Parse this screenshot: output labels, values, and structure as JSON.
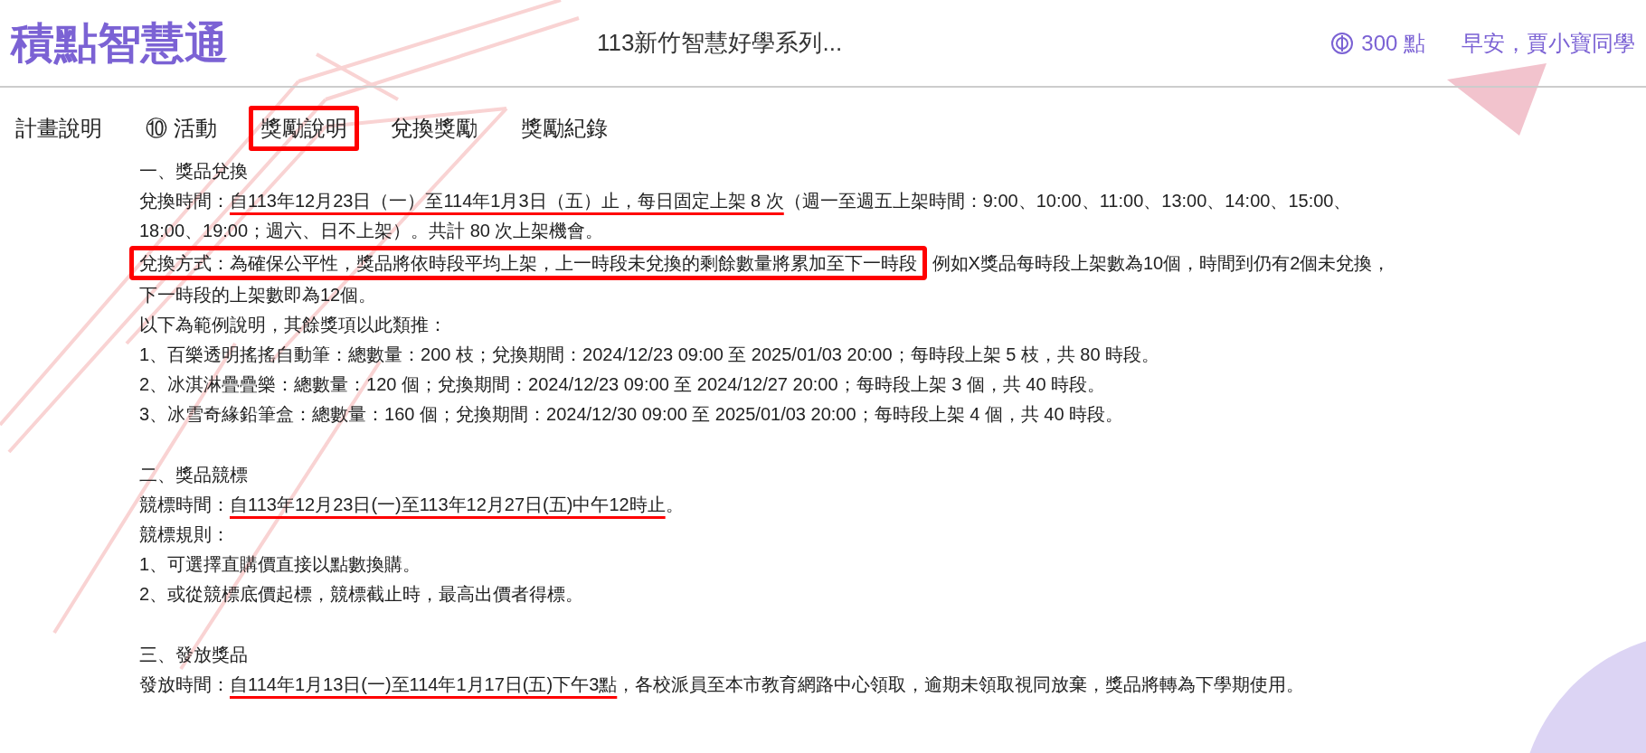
{
  "header": {
    "logo": "積點智慧通",
    "title": "113新竹智慧好學系列...",
    "points": "300 點",
    "greeting": "早安，賈小寶同學"
  },
  "tabs": [
    {
      "label": "計畫說明",
      "selected": false
    },
    {
      "label": "⑩ 活動",
      "selected": false
    },
    {
      "label": "獎勵說明",
      "selected": true
    },
    {
      "label": "兌換獎勵",
      "selected": false
    },
    {
      "label": "獎勵紀錄",
      "selected": false
    }
  ],
  "sections": [
    {
      "heading": "一、獎品兌換",
      "lines": [
        {
          "segments": [
            {
              "text": "兌換時間："
            },
            {
              "text": "自113年12月23日（一）至114年1月3日（五）止，每日固定上架 8 次",
              "underlined": true
            },
            {
              "text": "（週一至週五上架時間：9:00、10:00、11:00、13:00、14:00、15:00、"
            }
          ]
        },
        {
          "segments": [
            {
              "text": "18:00、19:00；週六、日不上架）。共計 80 次上架機會。"
            }
          ]
        },
        {
          "segments": [
            {
              "text": "兌換方式：為確保公平性，獎品將依時段平均上架，上一時段未兌換的剩餘數量將累加至下一時段",
              "boxed": true
            },
            {
              "text": " 例如X獎品每時段上架數為10個，時間到仍有2個未兌換，"
            }
          ]
        },
        {
          "segments": [
            {
              "text": "下一時段的上架數即為12個。"
            }
          ]
        },
        {
          "segments": [
            {
              "text": "以下為範例說明，其餘獎項以此類推："
            }
          ]
        },
        {
          "segments": [
            {
              "text": "1、百樂透明搖搖自動筆：總數量：200 枝；兌換期間：2024/12/23 09:00 至 2025/01/03 20:00；每時段上架 5 枝，共 80 時段。"
            }
          ]
        },
        {
          "segments": [
            {
              "text": "2、冰淇淋疊疊樂：總數量：120 個；兌換期間：2024/12/23 09:00 至 2024/12/27 20:00；每時段上架 3 個，共 40 時段。"
            }
          ]
        },
        {
          "segments": [
            {
              "text": "3、冰雪奇緣鉛筆盒：總數量：160 個；兌換期間：2024/12/30 09:00 至 2025/01/03 20:00；每時段上架 4 個，共 40 時段。"
            }
          ]
        }
      ]
    },
    {
      "heading": "二、獎品競標",
      "lines": [
        {
          "segments": [
            {
              "text": "競標時間："
            },
            {
              "text": "自113年12月23日(一)至113年12月27日(五)中午12時止",
              "underlined": true
            },
            {
              "text": "。"
            }
          ]
        },
        {
          "segments": [
            {
              "text": "競標規則："
            }
          ]
        },
        {
          "segments": [
            {
              "text": "1、可選擇直購價直接以點數換購。"
            }
          ]
        },
        {
          "segments": [
            {
              "text": "2、或從競標底價起標，競標截止時，最高出價者得標。"
            }
          ]
        }
      ]
    },
    {
      "heading": "三、發放獎品",
      "lines": [
        {
          "segments": [
            {
              "text": "發放時間："
            },
            {
              "text": "自114年1月13日(一)至114年1月17日(五)下午3點",
              "underlined": true
            },
            {
              "text": "，各校派員至本市教育網路中心領取，逾期未領取視同放棄，獎品將轉為下學期使用。"
            }
          ]
        }
      ]
    }
  ]
}
